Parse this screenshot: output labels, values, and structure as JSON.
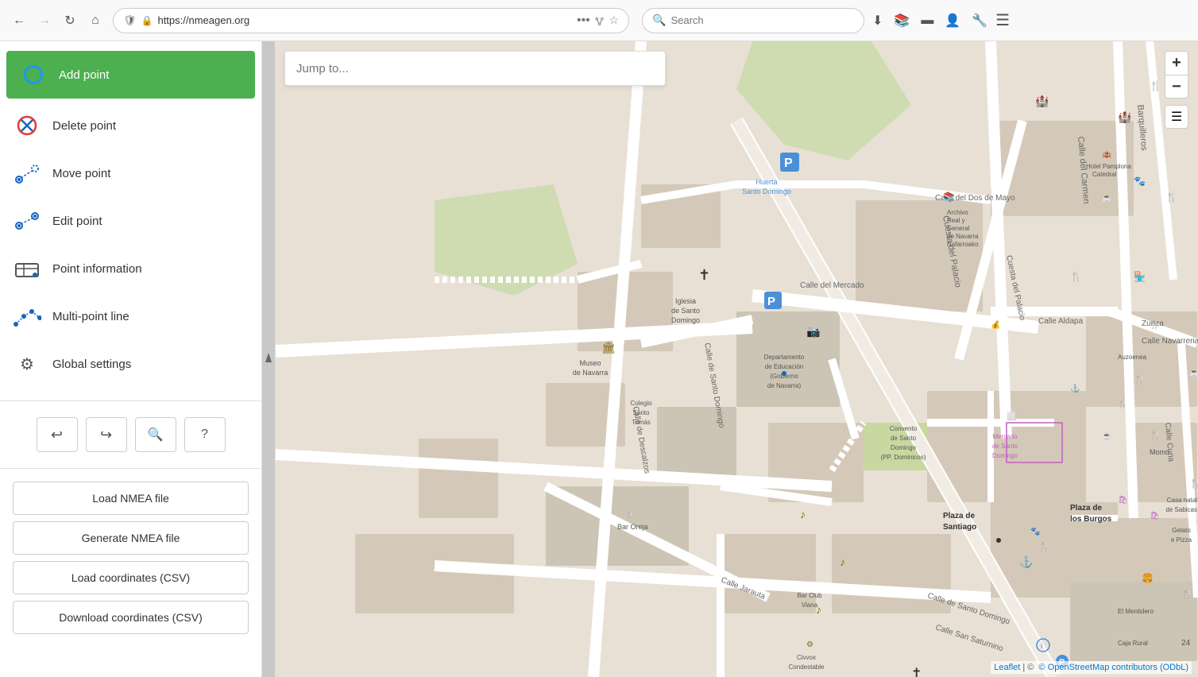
{
  "browser": {
    "back_disabled": false,
    "forward_disabled": true,
    "url": "https://nmeagen.org",
    "search_placeholder": "Search"
  },
  "sidebar": {
    "menu_items": [
      {
        "id": "add-point",
        "label": "Add point",
        "active": true
      },
      {
        "id": "delete-point",
        "label": "Delete point",
        "active": false
      },
      {
        "id": "move-point",
        "label": "Move point",
        "active": false
      },
      {
        "id": "edit-point",
        "label": "Edit point",
        "active": false
      },
      {
        "id": "point-information",
        "label": "Point information",
        "active": false
      },
      {
        "id": "multi-point-line",
        "label": "Multi-point line",
        "active": false
      },
      {
        "id": "global-settings",
        "label": "Global settings",
        "active": false
      }
    ],
    "controls": {
      "undo_label": "↩",
      "redo_label": "↪",
      "search_label": "🔍",
      "help_label": "?"
    },
    "actions": [
      {
        "id": "load-nmea",
        "label": "Load NMEA file"
      },
      {
        "id": "generate-nmea",
        "label": "Generate NMEA file"
      },
      {
        "id": "load-csv",
        "label": "Load coordinates (CSV)"
      },
      {
        "id": "download-csv",
        "label": "Download coordinates (CSV)"
      }
    ]
  },
  "map": {
    "jump_placeholder": "Jump to...",
    "zoom_in_label": "+",
    "zoom_out_label": "−",
    "attribution_leaflet": "Leaflet",
    "attribution_osm": "© OpenStreetMap contributors",
    "attribution_odbl": "(ODbL)"
  }
}
